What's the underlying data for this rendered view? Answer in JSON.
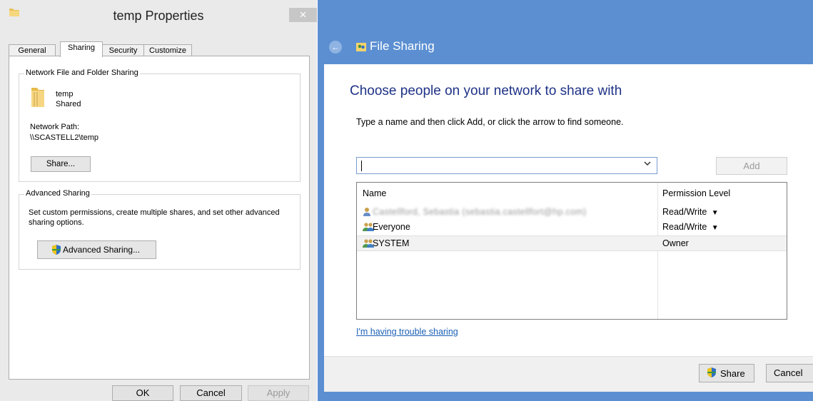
{
  "props": {
    "title": "temp Properties",
    "close_glyph": "×",
    "tabs": [
      "General",
      "Sharing",
      "Security",
      "Customize"
    ],
    "active_tab": "Sharing",
    "network_group": {
      "legend": "Network File and Folder Sharing",
      "folder_name": "temp",
      "folder_status": "Shared",
      "path_label": "Network Path:",
      "path_value": "\\\\SCASTELL2\\temp",
      "share_button": "Share..."
    },
    "advanced_group": {
      "legend": "Advanced Sharing",
      "description": "Set custom permissions, create multiple shares, and set other advanced sharing options.",
      "button": "Advanced Sharing..."
    },
    "buttons": {
      "ok": "OK",
      "cancel": "Cancel",
      "apply": "Apply"
    }
  },
  "sharing": {
    "window_title": "File Sharing",
    "back_glyph": "←",
    "heading": "Choose people on your network to share with",
    "instruction": "Type a name and then click Add, or click the arrow to find someone.",
    "input_value": "",
    "add_button": "Add",
    "columns": {
      "name": "Name",
      "permission": "Permission Level"
    },
    "rows": [
      {
        "name": "Castellford, Sebastia (sebastia.castellfort@hp.com)",
        "permission": "Read/Write",
        "has_dropdown": true,
        "icon": "user-icon"
      },
      {
        "name": "Everyone",
        "permission": "Read/Write",
        "has_dropdown": true,
        "icon": "group-icon"
      },
      {
        "name": "SYSTEM",
        "permission": "Owner",
        "has_dropdown": false,
        "icon": "group-icon"
      }
    ],
    "dropdown_glyph": "▼",
    "trouble_link": "I'm having trouble sharing",
    "share_button": "Share",
    "cancel_button": "Cancel"
  },
  "colors": {
    "accent_blue": "#5b8fd2",
    "heading_blue": "#1e3287",
    "link_blue": "#1a5fb4"
  }
}
